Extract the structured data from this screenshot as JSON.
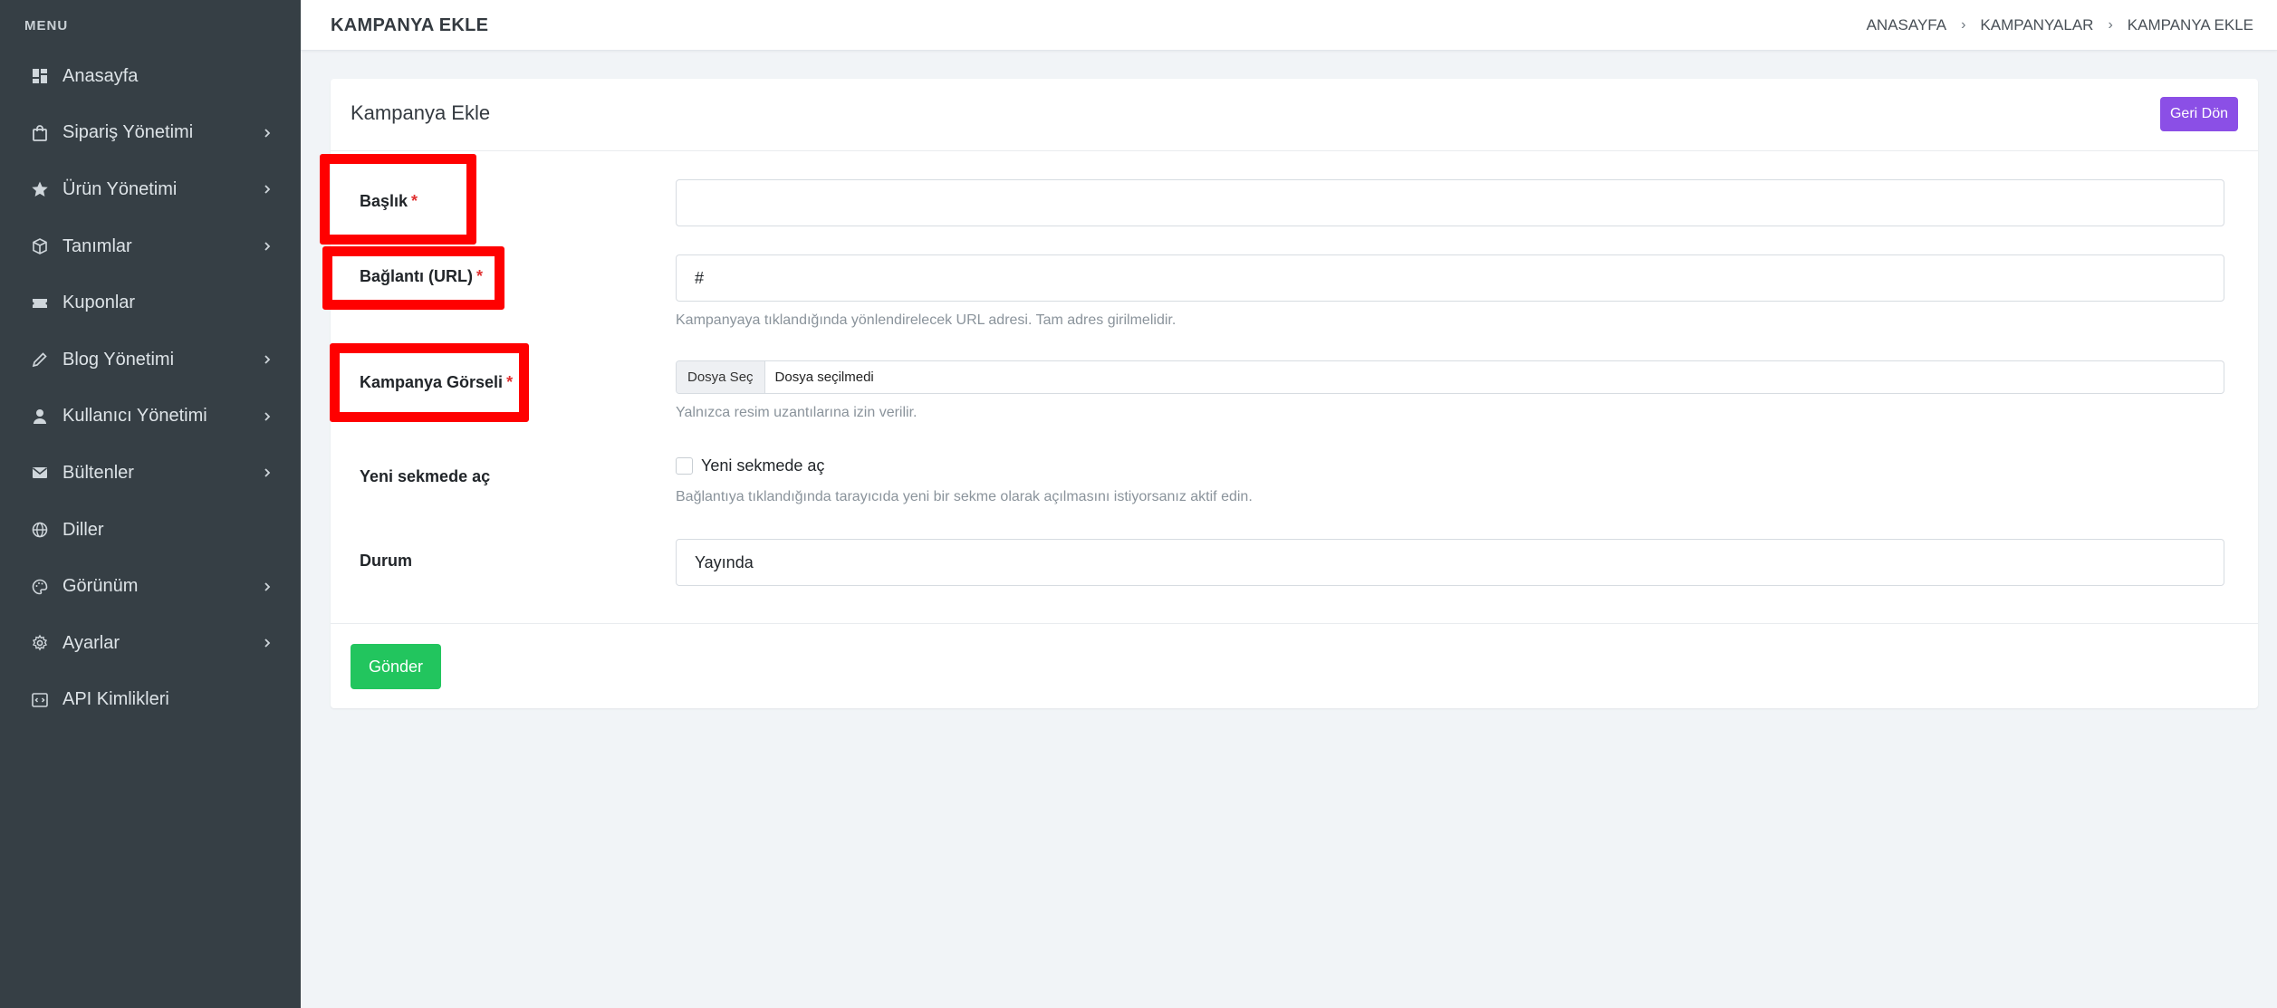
{
  "sidebar": {
    "menu_title": "MENU",
    "items": [
      {
        "label": "Anasayfa",
        "icon": "dashboard-icon",
        "has_children": false
      },
      {
        "label": "Sipariş Yönetimi",
        "icon": "shopping-bag-icon",
        "has_children": true
      },
      {
        "label": "Ürün Yönetimi",
        "icon": "star-icon",
        "has_children": true
      },
      {
        "label": "Tanımlar",
        "icon": "box-icon",
        "has_children": true
      },
      {
        "label": "Kuponlar",
        "icon": "ticket-icon",
        "has_children": false
      },
      {
        "label": "Blog Yönetimi",
        "icon": "pencil-icon",
        "has_children": true
      },
      {
        "label": "Kullanıcı Yönetimi",
        "icon": "user-icon",
        "has_children": true
      },
      {
        "label": "Bültenler",
        "icon": "mail-icon",
        "has_children": true
      },
      {
        "label": "Diller",
        "icon": "globe-icon",
        "has_children": false
      },
      {
        "label": "Görünüm",
        "icon": "palette-icon",
        "has_children": true
      },
      {
        "label": "Ayarlar",
        "icon": "gear-icon",
        "has_children": true
      },
      {
        "label": "API Kimlikleri",
        "icon": "code-icon",
        "has_children": false
      }
    ]
  },
  "header": {
    "title": "KAMPANYA EKLE",
    "breadcrumb": [
      "ANASAYFA",
      "KAMPANYALAR",
      "KAMPANYA EKLE"
    ]
  },
  "card": {
    "title": "Kampanya Ekle",
    "back_label": "Geri Dön"
  },
  "form": {
    "title_label": "Başlık",
    "title_value": "",
    "url_label": "Bağlantı (URL)",
    "url_value": "#",
    "url_help": "Kampanyaya tıklandığında yönlendirelecek URL adresi. Tam adres girilmelidir.",
    "image_label": "Kampanya Görseli",
    "file_button": "Dosya Seç",
    "file_status": "Dosya seçilmedi",
    "image_help": "Yalnızca resim uzantılarına izin verilir.",
    "newtab_label": "Yeni sekmede aç",
    "newtab_checkbox_label": "Yeni sekmede aç",
    "newtab_help": "Bağlantıya tıklandığında tarayıcıda yeni bir sekme olarak açılmasını istiyorsanız aktif edin.",
    "newtab_checked": false,
    "status_label": "Durum",
    "status_value": "Yayında",
    "required_mark": "*",
    "submit_label": "Gönder"
  },
  "colors": {
    "sidebar_bg": "#363f45",
    "accent_purple": "#8b4fe6",
    "submit_green": "#22c55e",
    "required_red": "#e03131",
    "highlight_red": "#ff0000"
  }
}
